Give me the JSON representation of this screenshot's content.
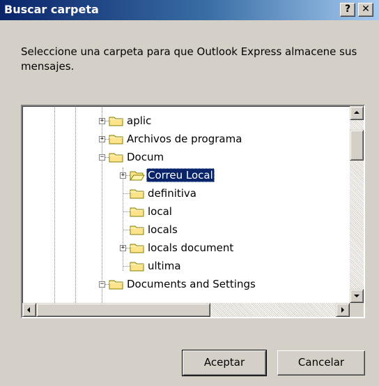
{
  "window": {
    "title": "Buscar carpeta",
    "help_label": "?",
    "close_label": "✕"
  },
  "prompt": "Seleccione una carpeta para que Outlook Express almacene sus mensajes.",
  "tree": {
    "items": [
      {
        "label": "aplic",
        "level": 0,
        "expander": "+"
      },
      {
        "label": "Archivos de programa",
        "level": 0,
        "expander": "+"
      },
      {
        "label": "Docum",
        "level": 0,
        "expander": "-"
      },
      {
        "label": "Correu Local",
        "level": 1,
        "expander": "+",
        "selected": true,
        "open_folder": true
      },
      {
        "label": "definitiva",
        "level": 1,
        "expander": ""
      },
      {
        "label": "local",
        "level": 1,
        "expander": ""
      },
      {
        "label": "locals",
        "level": 1,
        "expander": ""
      },
      {
        "label": "locals document",
        "level": 1,
        "expander": "+"
      },
      {
        "label": "ultima",
        "level": 1,
        "expander": ""
      },
      {
        "label": "Documents and Settings",
        "level": 0,
        "expander": "-"
      }
    ]
  },
  "buttons": {
    "ok": "Aceptar",
    "cancel": "Cancelar"
  },
  "colors": {
    "title_start": "#0a246a",
    "title_end": "#a6caf0",
    "dialog_bg": "#d4d0c8",
    "selection": "#0a246a",
    "folder": "#ffe38a"
  }
}
